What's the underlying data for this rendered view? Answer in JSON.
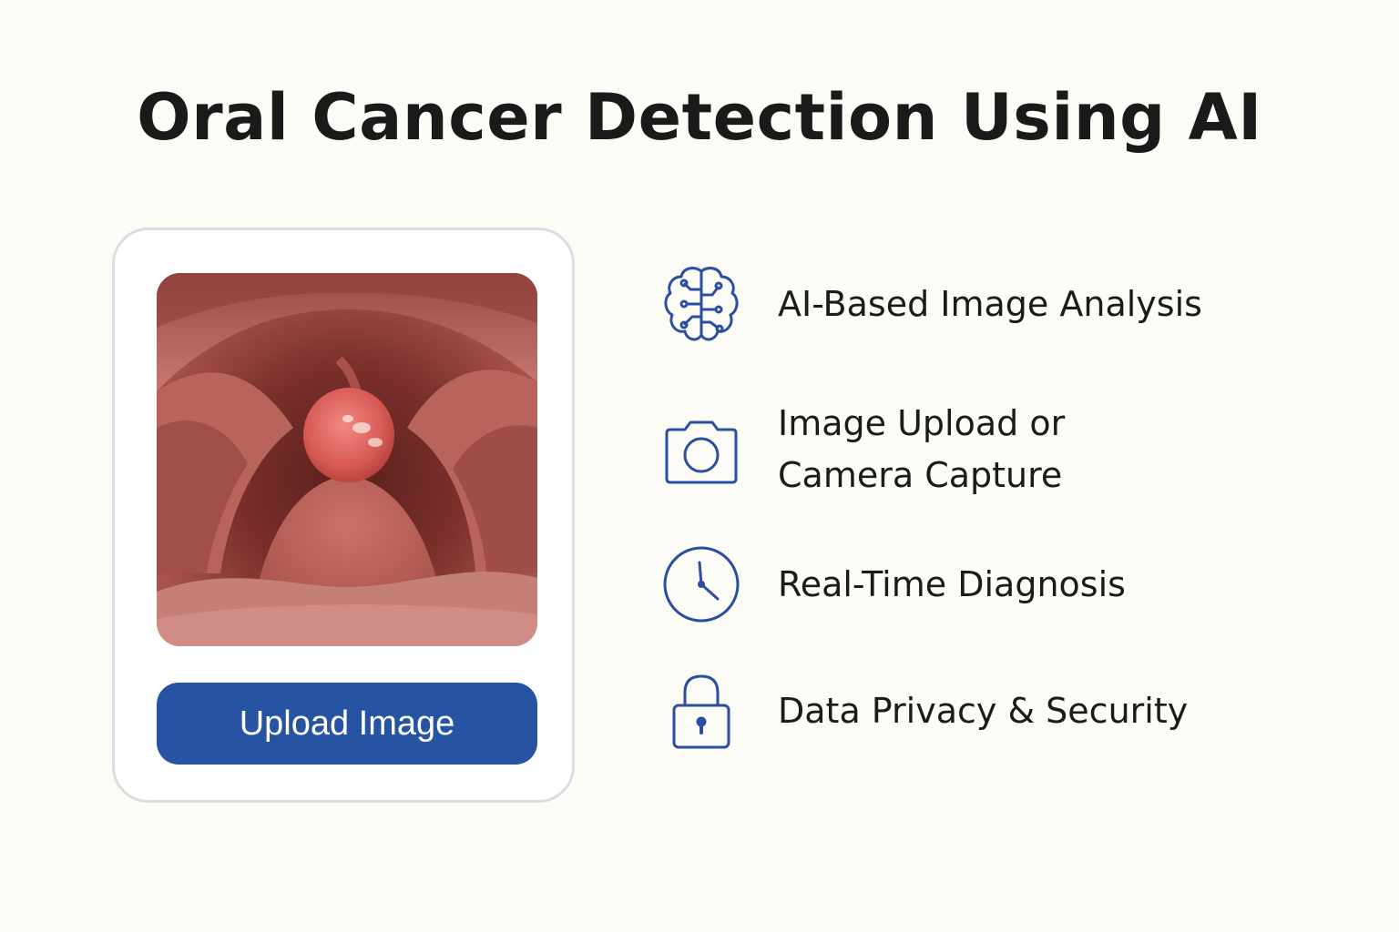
{
  "title": "Oral Cancer Detection Using AI",
  "upload_card": {
    "button_label": "Upload Image",
    "photo_alt": "oral cavity photo"
  },
  "features": [
    {
      "icon": "brain-circuit-icon",
      "label": "AI-Based Image Analysis"
    },
    {
      "icon": "camera-icon",
      "label_line1": "Image Upload or",
      "label_line2": "Camera Capture"
    },
    {
      "icon": "clock-icon",
      "label": "Real-Time Diagnosis"
    },
    {
      "icon": "lock-icon",
      "label": "Data Privacy & Security"
    }
  ],
  "colors": {
    "background": "#fcfbf6",
    "accent": "#2753a3",
    "icon_stroke": "#2a4ea0",
    "card_border": "#dcdde0",
    "title_text": "#1a1a1a"
  }
}
